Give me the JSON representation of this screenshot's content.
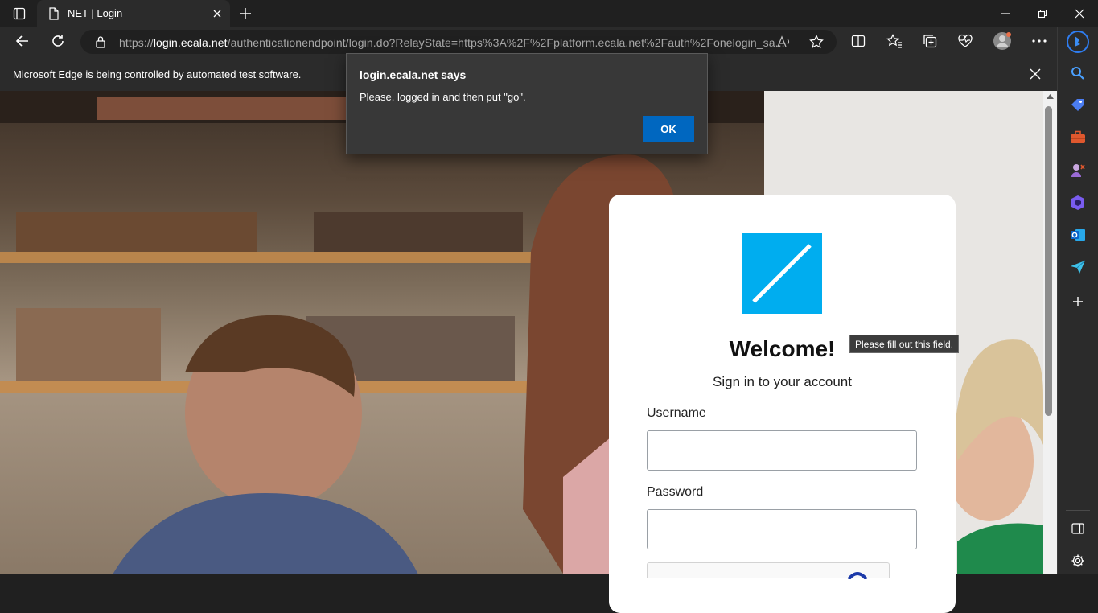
{
  "browser": {
    "tab_title": "NET | Login",
    "url_protocol": "https://",
    "url_host": "login.ecala.net",
    "url_rest": "/authenticationendpoint/login.do?RelayState=https%3A%2F%2Fplatform.ecala.net%2Fauth%2Fonelogin_sa...",
    "infobar_text": "Microsoft Edge is being controlled by automated test software."
  },
  "dialog": {
    "title": "login.ecala.net says",
    "message": "Please, logged in and then put \"go\".",
    "ok_label": "OK"
  },
  "login": {
    "welcome": "Welcome!",
    "subtitle": "Sign in to your account",
    "username_label": "Username",
    "username_value": "",
    "password_label": "Password",
    "password_value": ""
  },
  "tooltip": {
    "text": "Please fill out this field."
  },
  "colors": {
    "brand": "#00adef",
    "accent": "#0067c0",
    "chrome": "#2b2b2b"
  },
  "icons": {
    "sidebar": [
      "search-icon",
      "shopping-tag-icon",
      "toolbox-icon",
      "games-icon",
      "office-icon",
      "outlook-icon",
      "send-icon",
      "add-icon",
      "split-screen-icon",
      "settings-icon"
    ]
  }
}
